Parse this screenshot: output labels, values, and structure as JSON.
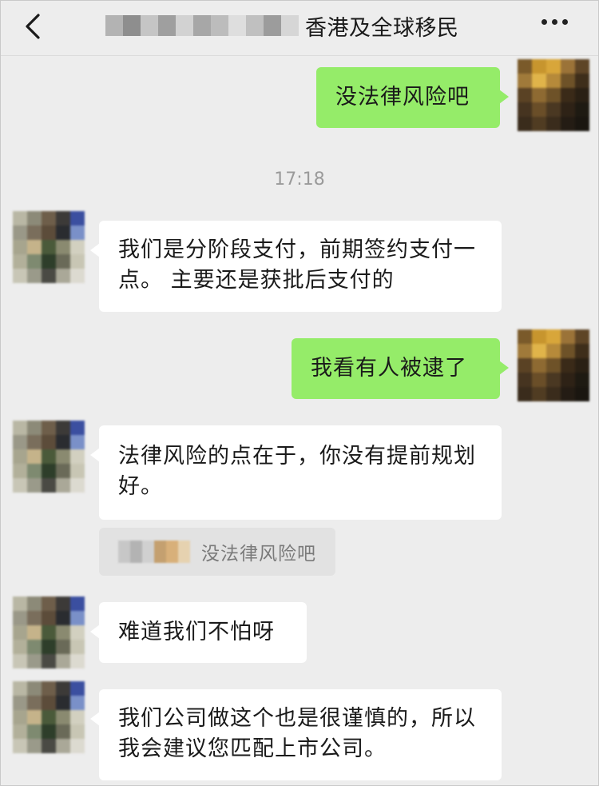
{
  "header": {
    "title": "香港及全球移民",
    "back_icon": "chevron-left-icon",
    "more_icon": "more-dots-icon"
  },
  "messages": [
    {
      "side": "me",
      "text": "没法律风险吧"
    },
    {
      "side": "them",
      "text": "我们是分阶段支付，前期签约支付一点。 主要还是获批后支付的"
    },
    {
      "side": "me",
      "text": "我看有人被逮了"
    },
    {
      "side": "them",
      "text": "法律风险的点在于，你没有提前规划好。"
    },
    {
      "side": "them",
      "text": "难道我们不怕呀"
    },
    {
      "side": "them",
      "text": "我们公司做这个也是很谨慎的，所以我会建议您匹配上市公司。"
    }
  ],
  "timestamp": "17:18",
  "quote": {
    "text": "没法律风险吧"
  },
  "colors": {
    "my_bubble": "#95ec69",
    "their_bubble": "#ffffff",
    "background": "#ededed"
  }
}
